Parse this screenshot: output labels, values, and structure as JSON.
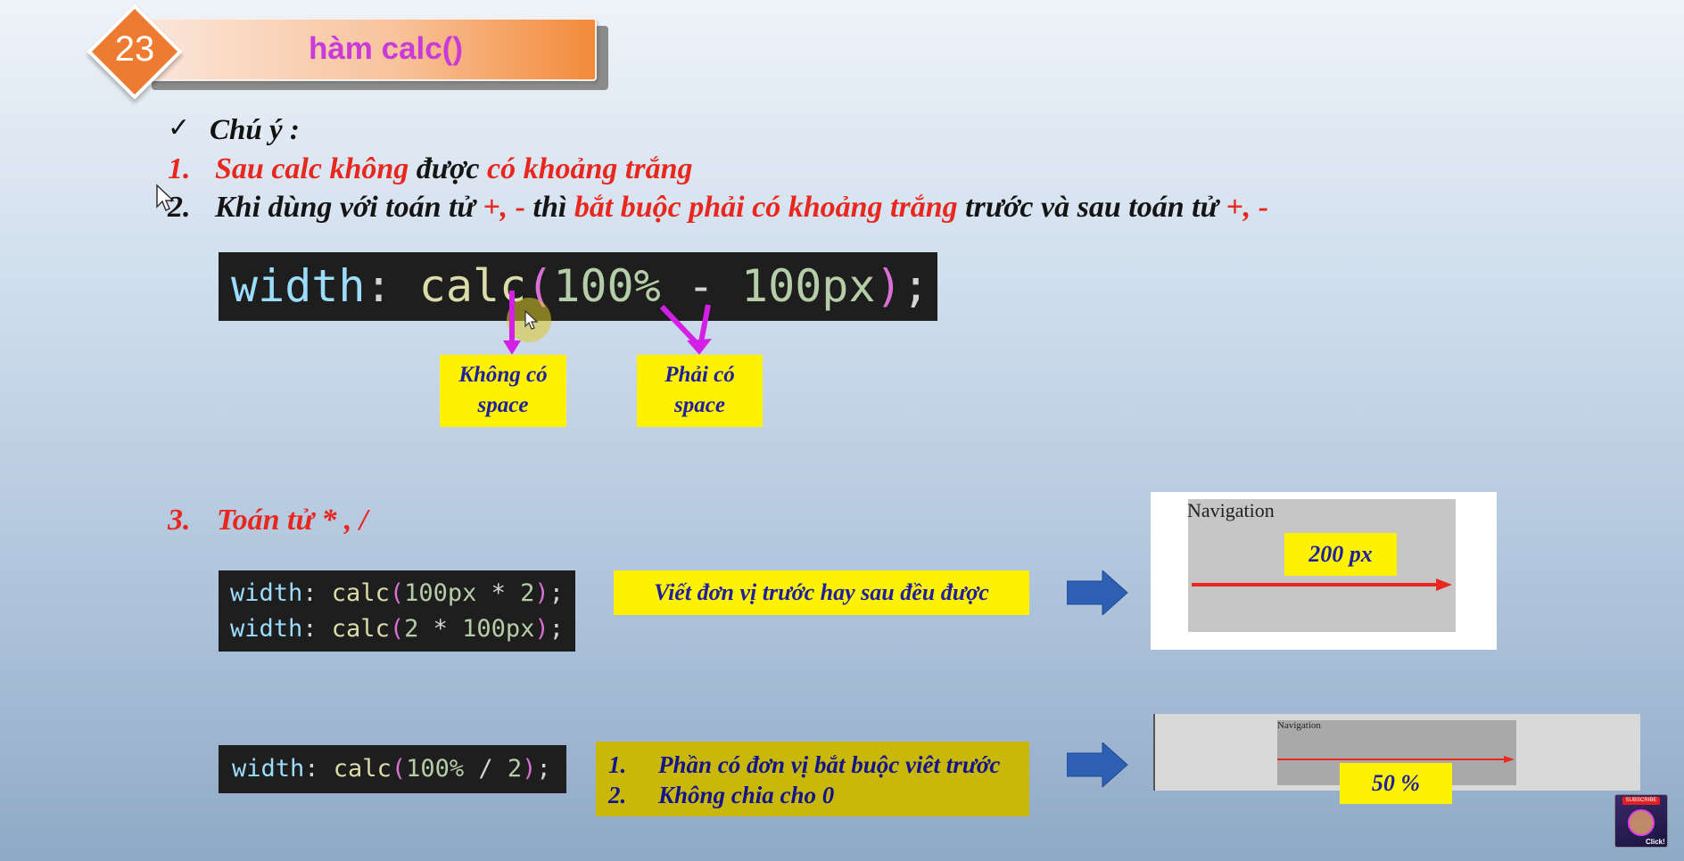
{
  "slide": {
    "number": "23",
    "title": "hàm calc()"
  },
  "notes": {
    "heading_check": "✓",
    "heading": "Chú ý :",
    "item1": {
      "num": "1.",
      "part1": "Sau calc không",
      "part2": " được ",
      "part3": "có khoảng trắng"
    },
    "item2": {
      "num": "2.",
      "part1": "Khi dùng với toán tử ",
      "part2": "+, -",
      "part3": " thì ",
      "part4": "bắt buộc phải có khoảng trắng",
      "part5": " trước và sau toán tử ",
      "part6": "+, -"
    },
    "item3": {
      "num": "3.",
      "text": "Toán tử * , /"
    }
  },
  "code_main": {
    "prop": "width",
    "colon": ": ",
    "fn": "calc",
    "open": "(",
    "arg1": "100%",
    "op": " - ",
    "arg2": "100px",
    "close": ")",
    "semi": ";"
  },
  "labels": {
    "no_space": [
      "Không có",
      "space"
    ],
    "must_space": [
      "Phải có",
      "space"
    ]
  },
  "code_mul": {
    "line1": {
      "prop": "width",
      "colon": ": ",
      "fn": "calc",
      "open": "(",
      "a": "100px",
      "op": " * ",
      "b": "2",
      "close": ")",
      "semi": ";"
    },
    "line2": {
      "prop": "width",
      "colon": ": ",
      "fn": "calc",
      "open": "(",
      "a": "2",
      "op": " * ",
      "b": "100px",
      "close": ")",
      "semi": ";"
    }
  },
  "mul_note": "Viết đơn vị trước hay sau đều được",
  "demo1": {
    "nav_label": "Navigation",
    "size_label": "200 px"
  },
  "code_div": {
    "prop": "width",
    "colon": ": ",
    "fn": "calc",
    "open": "(",
    "a": "100%",
    "op": " / ",
    "b": "2",
    "close": ")",
    "semi": ";"
  },
  "div_notes": [
    {
      "num": "1.",
      "text": "Phần có đơn vị bắt buộc viêt trước"
    },
    {
      "num": "2.",
      "text": "Không chia cho 0"
    }
  ],
  "demo2": {
    "nav_label": "Navigation",
    "size_label": "50 %"
  },
  "colors": {
    "red": "#e8281e",
    "magenta": "#d41fe6",
    "arrow_blue": "#2f5fb3",
    "yellow": "#fff200",
    "olive": "#c9b80a",
    "orange": "#ee7b32"
  },
  "thumbnail": {
    "badge": "SUBSCRIBE",
    "caption": "Click!"
  }
}
